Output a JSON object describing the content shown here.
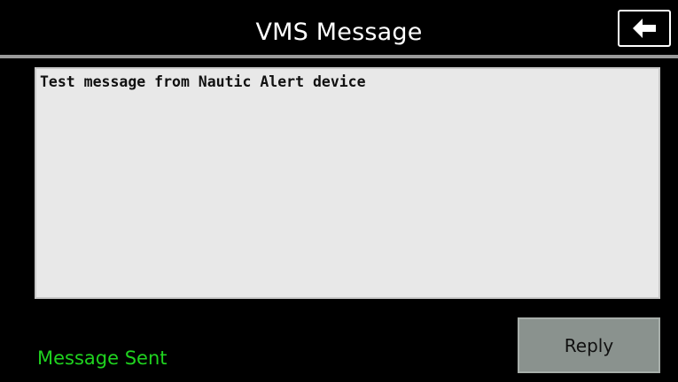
{
  "header": {
    "title": "VMS Message",
    "back_icon": "arrow-left-icon"
  },
  "message": {
    "text": "Test message from Nautic Alert device"
  },
  "footer": {
    "status": "Message Sent",
    "reply_label": "Reply"
  },
  "colors": {
    "background": "#000000",
    "divider": "#9a9a9a",
    "message_bg": "#e8e8e8",
    "status_text": "#1fd31f",
    "reply_button_bg": "#8a928e"
  }
}
